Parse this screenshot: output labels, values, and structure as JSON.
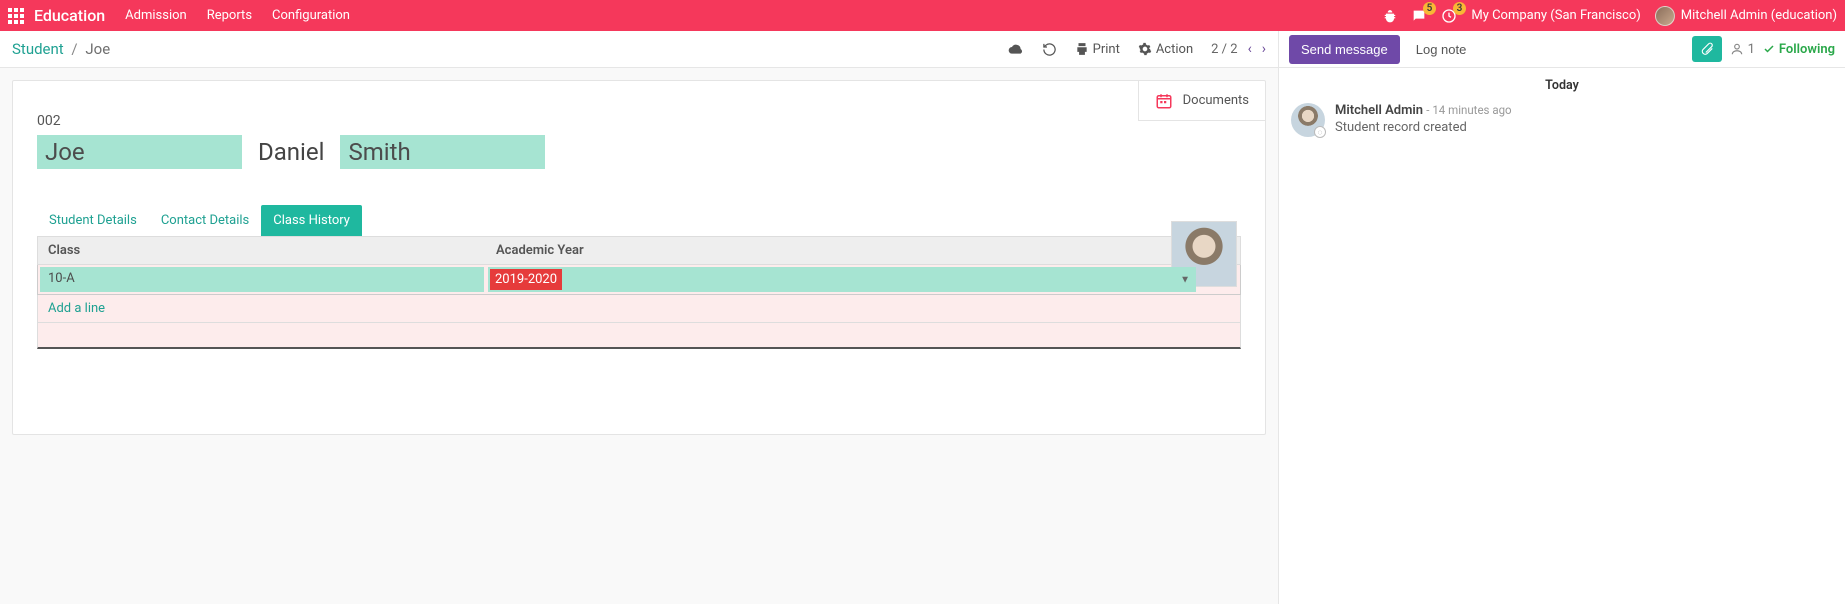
{
  "nav": {
    "brand": "Education",
    "menu": [
      "Admission",
      "Reports",
      "Configuration"
    ],
    "messages_badge": "5",
    "activities_badge": "3",
    "company": "My Company (San Francisco)",
    "user": "Mitchell Admin (education)"
  },
  "toolbar": {
    "breadcrumb_root": "Student",
    "breadcrumb_current": "Joe",
    "print": "Print",
    "action": "Action",
    "pager": "2 / 2"
  },
  "docbtn": {
    "label": "Documents"
  },
  "form": {
    "reg_no": "002",
    "first_name": "Joe",
    "middle_name": "Daniel",
    "last_name": "Smith"
  },
  "tabs": [
    "Student Details",
    "Contact Details",
    "Class History"
  ],
  "table": {
    "headers": {
      "class": "Class",
      "year": "Academic Year"
    },
    "rows": [
      {
        "class": "10-A",
        "year": "2019-2020"
      }
    ],
    "addline": "Add a line"
  },
  "chatter": {
    "send": "Send message",
    "lognote": "Log note",
    "followers": "1",
    "following": "Following",
    "today": "Today",
    "msg": {
      "author": "Mitchell Admin",
      "time": "14 minutes ago",
      "text": "Student record created"
    }
  }
}
